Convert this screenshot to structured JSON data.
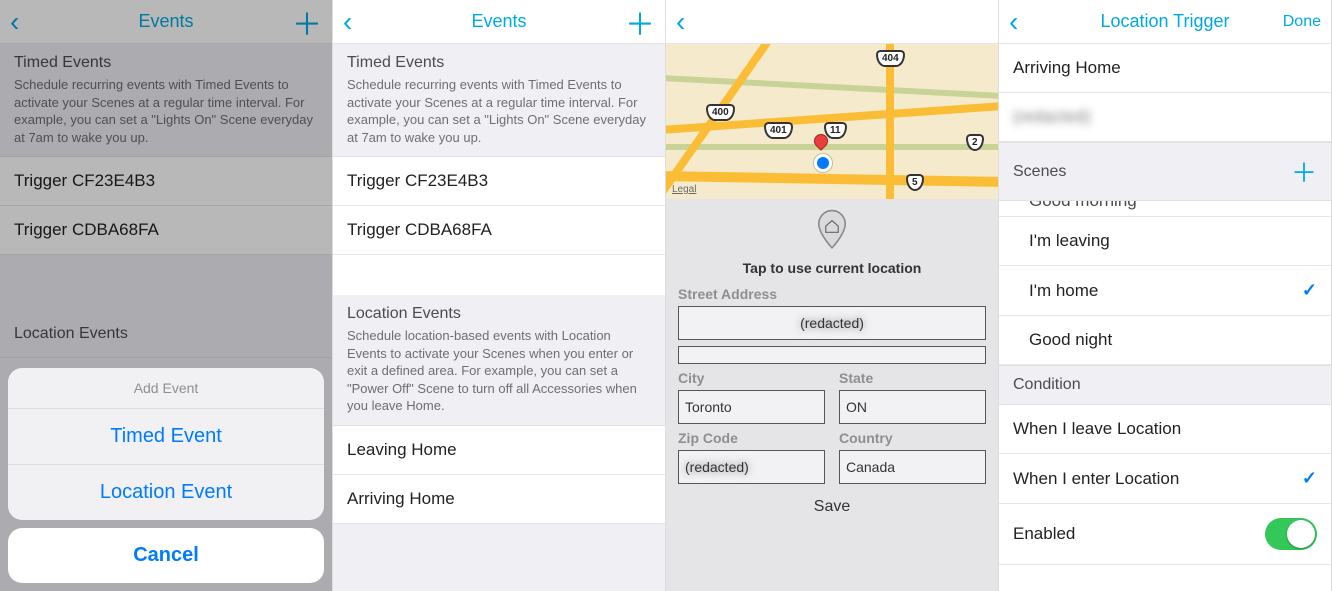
{
  "accent": "#00a9e0",
  "screen1": {
    "title": "Events",
    "section_timed_title": "Timed Events",
    "section_timed_desc": "Schedule recurring events with Timed Events to activate your Scenes at a regular time interval. For example, you can set a \"Lights On\" Scene everyday at 7am to wake you up.",
    "triggers": [
      "Trigger CF23E4B3",
      "Trigger CDBA68FA"
    ],
    "section_loc_title": "Location Events",
    "sheet_title": "Add Event",
    "sheet_options": [
      "Timed Event",
      "Location Event"
    ],
    "sheet_cancel": "Cancel"
  },
  "screen2": {
    "title": "Events",
    "section_timed_title": "Timed Events",
    "section_timed_desc": "Schedule recurring events with Timed Events to activate your Scenes at a regular time interval. For example, you can set a \"Lights On\" Scene everyday at 7am to wake you up.",
    "triggers": [
      "Trigger CF23E4B3",
      "Trigger CDBA68FA"
    ],
    "section_loc_title": "Location Events",
    "section_loc_desc": "Schedule location-based events with Location Events to activate your Scenes when you enter or exit a defined area. For example, you can set a \"Power Off\" Scene to turn off all Accessories when you leave Home.",
    "loc_events": [
      "Leaving Home",
      "Arriving Home"
    ]
  },
  "screen3": {
    "legal": "Legal",
    "shields": [
      "404",
      "400",
      "401",
      "11",
      "2",
      "5"
    ],
    "tap_text": "Tap to use current location",
    "labels": {
      "street": "Street Address",
      "city": "City",
      "state": "State",
      "zip": "Zip Code",
      "country": "Country"
    },
    "values": {
      "street1": "(redacted)",
      "street2": "",
      "city": "Toronto",
      "state": "ON",
      "zip": "(redacted)",
      "country": "Canada"
    },
    "save": "Save"
  },
  "screen4": {
    "title": "Location Trigger",
    "done": "Done",
    "name_row": "Arriving Home",
    "address_row": "(redacted)",
    "scenes_header": "Scenes",
    "scene_peek": "Good morning",
    "scenes": [
      "I'm leaving",
      "I'm home",
      "Good night"
    ],
    "scene_checked": "I'm home",
    "condition_header": "Condition",
    "conditions": [
      "When I leave Location",
      "When I enter Location"
    ],
    "condition_checked": "When I enter Location",
    "enabled_label": "Enabled",
    "enabled": true
  }
}
